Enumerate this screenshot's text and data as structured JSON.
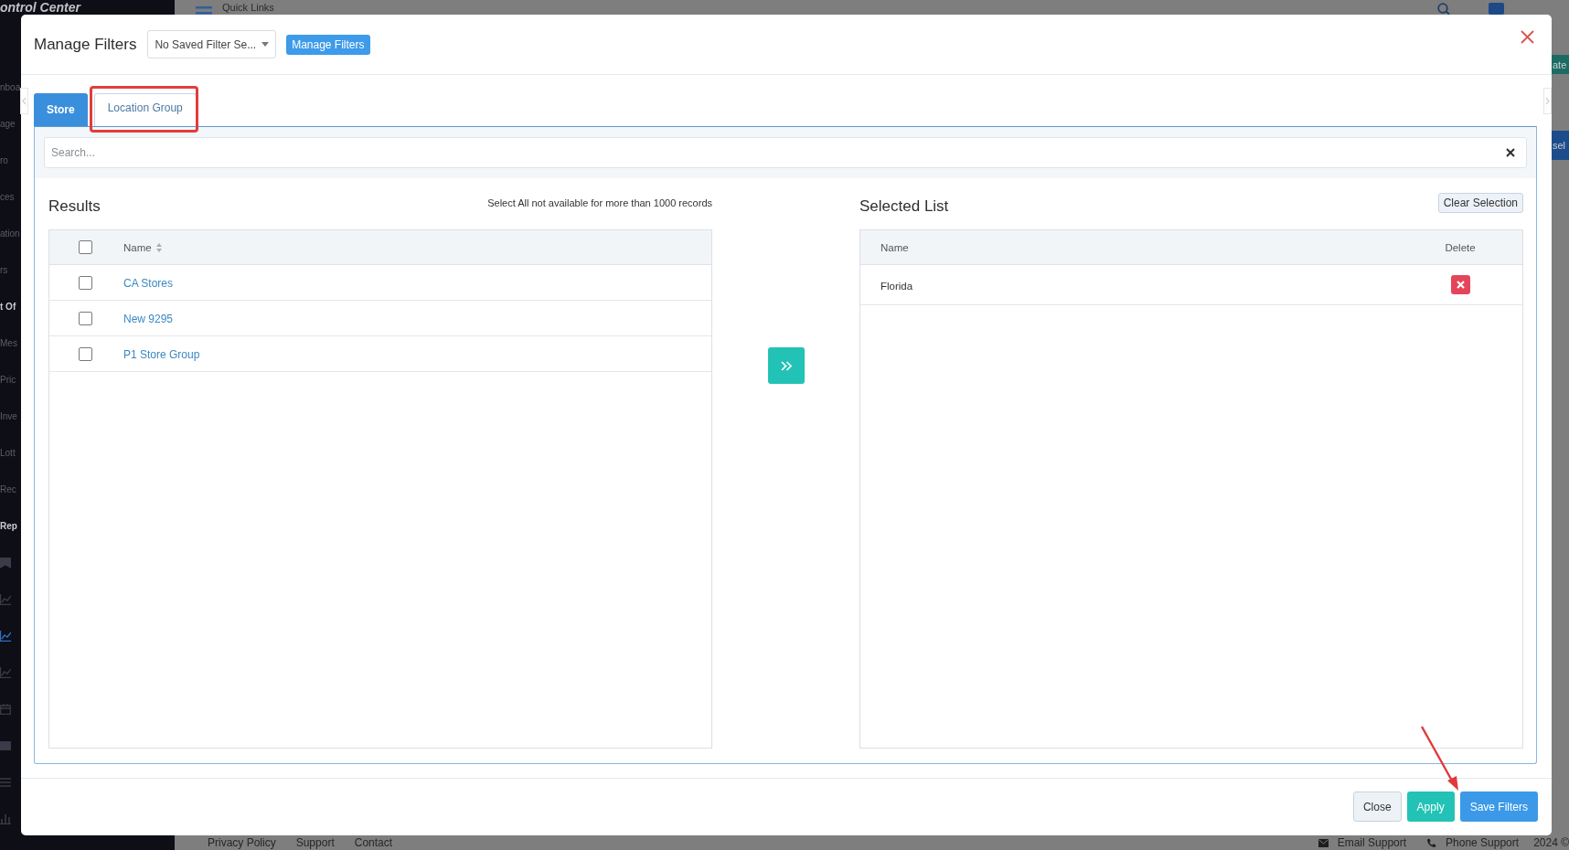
{
  "background": {
    "sidebar": {
      "logo": "ontrol Center",
      "items": [
        {
          "label": "nboa",
          "kind": "item"
        },
        {
          "label": "age",
          "kind": "item"
        },
        {
          "label": "ro",
          "kind": "item"
        },
        {
          "label": "ces",
          "kind": "item"
        },
        {
          "label": "ation",
          "kind": "item"
        },
        {
          "label": "rs",
          "kind": "item"
        },
        {
          "label": "t Of",
          "kind": "heading"
        },
        {
          "label": "Mes",
          "kind": "item"
        },
        {
          "label": "Pric",
          "kind": "item"
        },
        {
          "label": "Inve",
          "kind": "item"
        },
        {
          "label": "Lott",
          "kind": "item"
        },
        {
          "label": "Rec",
          "kind": "item"
        },
        {
          "label": "Rep",
          "kind": "heading"
        }
      ],
      "icons": [
        {
          "kind": "bookmark",
          "selected": false
        },
        {
          "kind": "chart",
          "selected": false
        },
        {
          "kind": "chart",
          "selected": true
        },
        {
          "kind": "chart",
          "selected": false
        },
        {
          "kind": "calendar",
          "selected": false
        },
        {
          "kind": "card",
          "selected": false
        },
        {
          "kind": "list",
          "selected": false
        },
        {
          "kind": "bars",
          "selected": false
        }
      ]
    },
    "header": {
      "title": "Quick Links"
    },
    "edge_buttons": [
      {
        "label": "ate",
        "kind": "success"
      },
      {
        "label": "sel",
        "kind": "primary"
      }
    ],
    "footer": {
      "links": [
        "Privacy Policy",
        "Support",
        "Contact"
      ],
      "contacts": [
        {
          "kind": "email",
          "label": "Email Support"
        },
        {
          "kind": "phone",
          "label": "Phone Support"
        }
      ],
      "copyright": "2024 ©"
    }
  },
  "modal": {
    "title": "Manage Filters",
    "saved_filter": {
      "value": "No Saved Filter Se..."
    },
    "manage_button": "Manage Filters",
    "tabs": [
      {
        "label": "Store",
        "selected": false,
        "highlighted": false
      },
      {
        "label": "Location Group",
        "selected": true,
        "highlighted": true
      }
    ],
    "search": {
      "placeholder": "Search..."
    },
    "results": {
      "title": "Results",
      "note": "Select All not available for more than 1000 records",
      "select_all": {
        "checked": false
      },
      "columns": [
        {
          "label": "Name",
          "sortable": true
        }
      ],
      "rows": [
        {
          "name": "CA Stores",
          "checked": false
        },
        {
          "name": "New 9295",
          "checked": false
        },
        {
          "name": "P1 Store Group",
          "checked": false
        }
      ]
    },
    "selected_list": {
      "title": "Selected List",
      "clear_button": "Clear Selection",
      "columns": [
        {
          "label": "Name"
        },
        {
          "label": "Delete"
        }
      ],
      "rows": [
        {
          "name": "Florida"
        }
      ]
    },
    "buttons": [
      {
        "kind": "close",
        "label": "Close"
      },
      {
        "kind": "apply",
        "label": "Apply"
      },
      {
        "kind": "save",
        "label": "Save Filters"
      }
    ],
    "annotations": [
      {
        "kind": "arrow"
      }
    ]
  }
}
